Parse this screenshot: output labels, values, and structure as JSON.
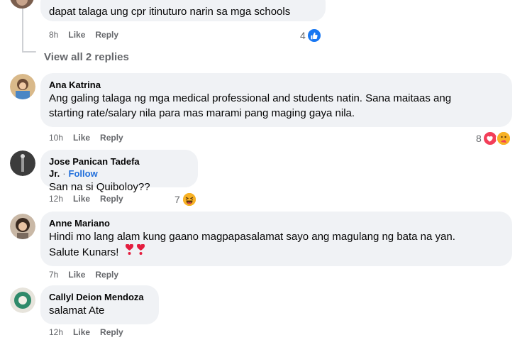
{
  "top_reply": {
    "text": "dapat talaga ung cpr itinuturo narin sa mga schools",
    "time": "8h",
    "like": "Like",
    "reply": "Reply",
    "reaction_count": "4"
  },
  "view_replies": "View all 2 replies",
  "comments": [
    {
      "name": "Ana Katrina",
      "text_lines": [
        "Ang galing talaga ng mga medical professional and students natin. Sana maitaas ang",
        "starting rate/salary nila para mas marami pang maging gaya nila."
      ],
      "time": "10h",
      "like": "Like",
      "reply": "Reply",
      "reaction_count": "8"
    },
    {
      "name": "Jose Panican Tadefa Jr.",
      "follow": "Follow",
      "text": "San na si Quiboloy??",
      "time": "12h",
      "like": "Like",
      "reply": "Reply",
      "reaction_count": "7"
    },
    {
      "name": "Anne Mariano",
      "text_lines": [
        "Hindi mo lang alam kung gaano magpapasalamat sayo ang magulang ng bata na yan.",
        "Salute Kunars!"
      ],
      "time": "7h",
      "like": "Like",
      "reply": "Reply"
    },
    {
      "name": "Callyl Deion Mendoza",
      "text": "salamat Ate",
      "time": "12h",
      "like": "Like",
      "reply": "Reply"
    }
  ],
  "colors": {
    "bubble": "#f0f2f5",
    "meta": "#65676b",
    "follow": "#216fdb",
    "like_blue": "#1877f2",
    "love_red": "#f33e58",
    "haha_yellow": "#f7b125"
  },
  "icons": [
    "like-reaction-icon",
    "love-reaction-icon",
    "care-reaction-icon",
    "haha-reaction-icon",
    "heart-exclamation-emoji"
  ]
}
